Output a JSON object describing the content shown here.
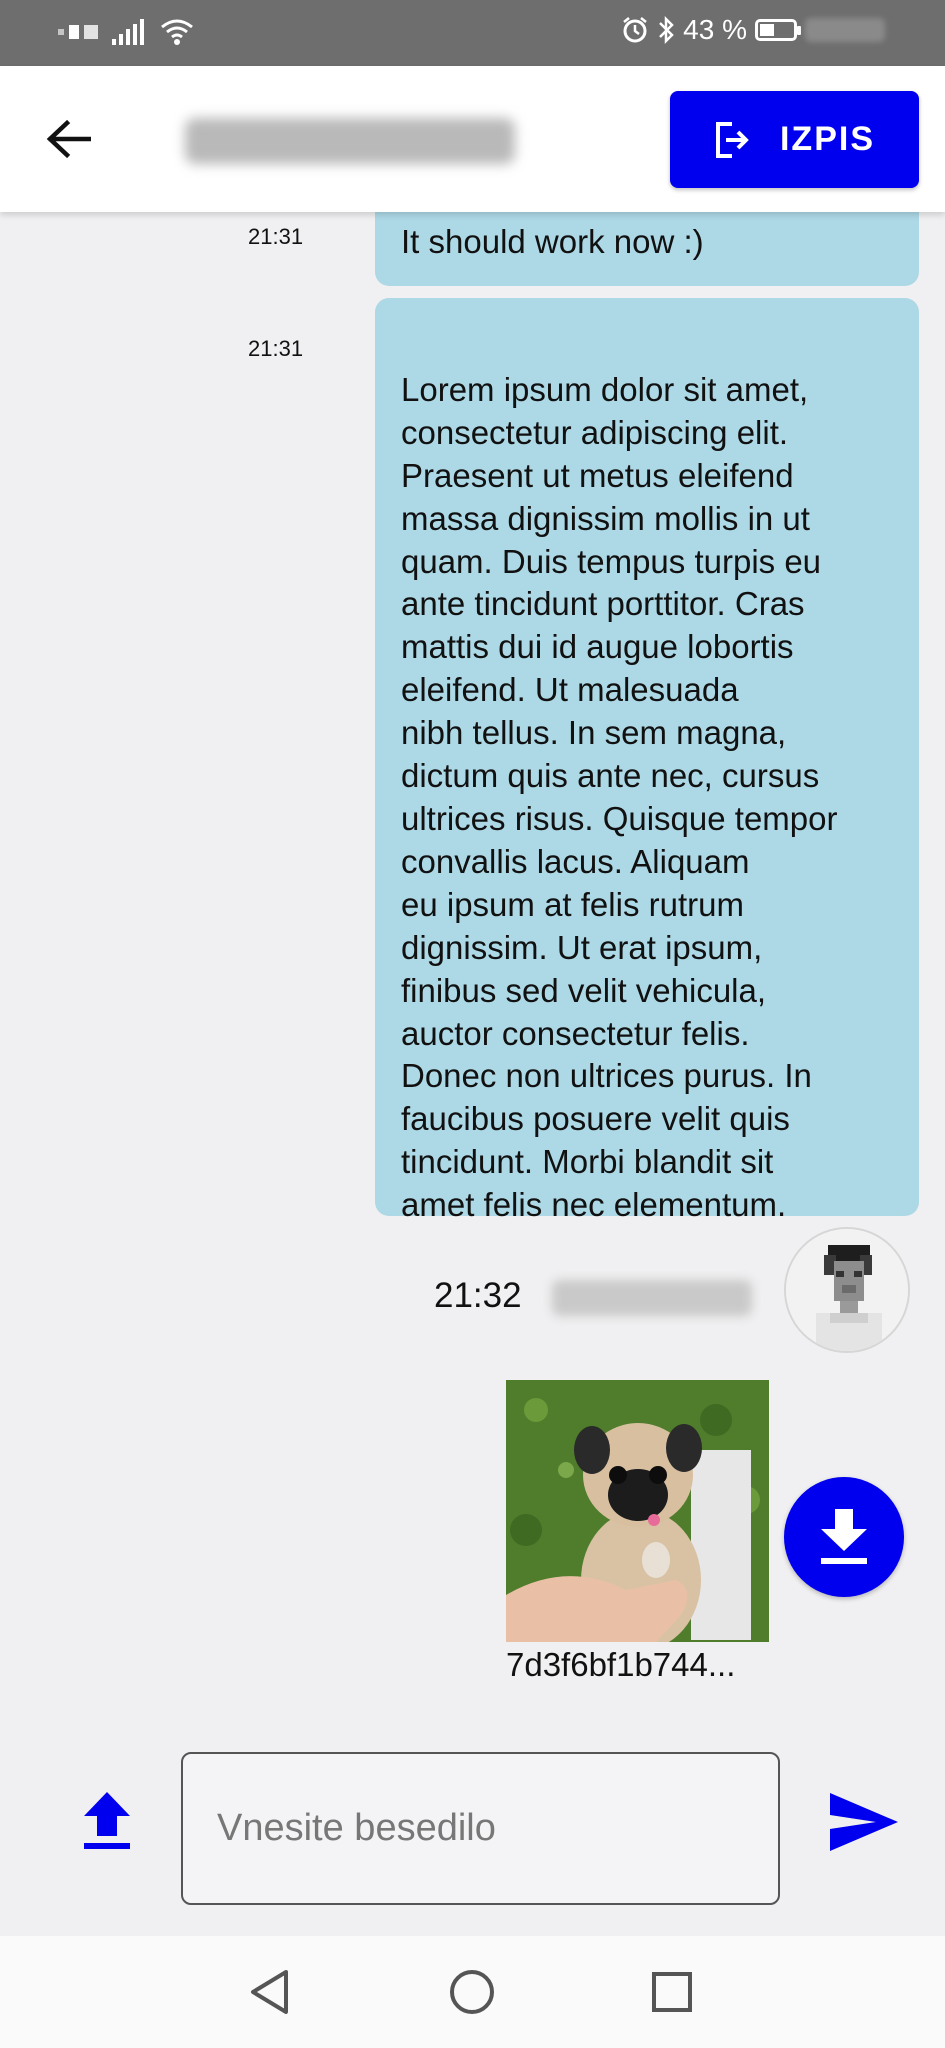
{
  "status_bar": {
    "battery_text": "43 %",
    "battery_level": 0.43,
    "icons": [
      "sim-icon",
      "signal-icon",
      "wifi-icon",
      "alarm-icon",
      "bluetooth-icon",
      "battery-icon"
    ]
  },
  "header": {
    "back_icon": "arrow-left-icon",
    "logout_label": "IZPIS",
    "logout_icon": "logout-icon",
    "accent_color": "#0000ee"
  },
  "messages": [
    {
      "time": "21:31",
      "text": "It should work now :)"
    },
    {
      "time": "21:31",
      "text": "Lorem ipsum dolor sit amet,\nconsectetur adipiscing elit.\nPraesent ut metus eleifend\nmassa dignissim mollis in ut\nquam. Duis tempus turpis eu\nante tincidunt porttitor. Cras\nmattis dui id augue lobortis\neleifend. Ut malesuada\nnibh tellus. In sem magna,\ndictum quis ante nec, cursus\nultrices risus. Quisque tempor\nconvallis lacus. Aliquam\neu ipsum at felis rutrum\ndignissim. Ut erat ipsum,\nfinibus sed velit vehicula,\nauctor consectetur felis.\nDonec non ultrices purus. In\nfaucibus posuere velit quis\ntincidunt. Morbi blandit sit\namet felis nec elementum."
    }
  ],
  "incoming": {
    "time": "21:32",
    "file_name": "7d3f6bf1b744...",
    "download_icon": "download-icon"
  },
  "composer": {
    "placeholder": "Vnesite besedilo",
    "value": "",
    "upload_icon": "upload-icon",
    "send_icon": "send-icon"
  },
  "navbar": {
    "icons": [
      "nav-back-icon",
      "nav-home-icon",
      "nav-recents-icon"
    ]
  },
  "colors": {
    "bubble": "#add8e6",
    "accent": "#0000ee",
    "background": "#f0f0f2"
  }
}
